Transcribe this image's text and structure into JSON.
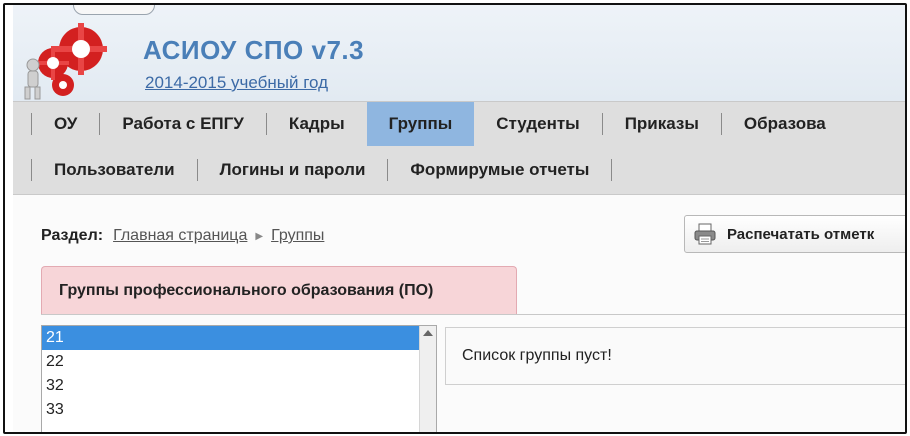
{
  "header": {
    "app_title": "АСИОУ СПО v7.3",
    "year_link": "2014-2015 учебный год"
  },
  "nav": {
    "row1": [
      {
        "label": "ОУ"
      },
      {
        "label": "Работа с ЕПГУ"
      },
      {
        "label": "Кадры"
      },
      {
        "label": "Группы",
        "active": true
      },
      {
        "label": "Студенты"
      },
      {
        "label": "Приказы"
      },
      {
        "label": "Образова"
      }
    ],
    "row2": [
      {
        "label": "Пользователи"
      },
      {
        "label": "Логины и пароли"
      },
      {
        "label": "Формирумые отчеты"
      }
    ]
  },
  "breadcrumb": {
    "label": "Раздел:",
    "items": [
      "Главная страница",
      "Группы"
    ]
  },
  "print_button": {
    "label": "Распечатать отметк",
    "icon": "printer-icon"
  },
  "section_tab": {
    "label": "Группы профессионального образования (ПО)"
  },
  "group_list": {
    "items": [
      "21",
      "22",
      "32",
      "33"
    ],
    "selected": "21"
  },
  "panel": {
    "message": "Список группы пуст!"
  },
  "colors": {
    "accent": "#8fb6e0",
    "selection": "#3b8fe0",
    "tab_pink": "#f7d5d8",
    "title_blue": "#4a7fb8"
  }
}
